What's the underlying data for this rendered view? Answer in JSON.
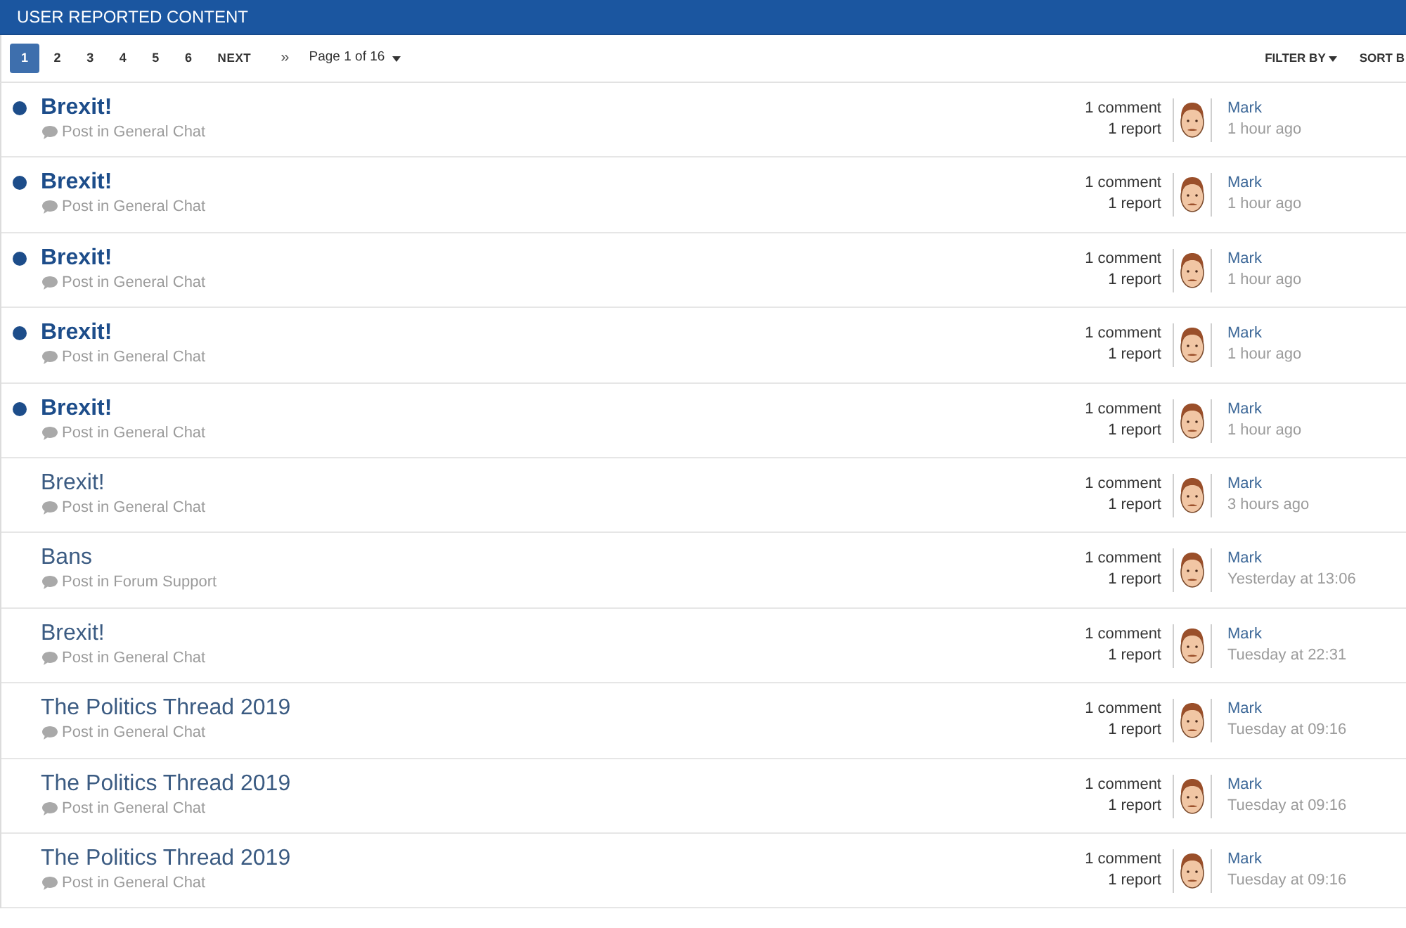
{
  "header": {
    "title": "USER REPORTED CONTENT"
  },
  "pagination": {
    "pages": [
      {
        "label": "1",
        "selected": true
      },
      {
        "label": "2",
        "selected": false
      },
      {
        "label": "3",
        "selected": false
      },
      {
        "label": "4",
        "selected": false
      },
      {
        "label": "5",
        "selected": false
      },
      {
        "label": "6",
        "selected": false
      }
    ],
    "next": "NEXT",
    "last": "»",
    "page_menu": "Page 1 of 16"
  },
  "toolbar": {
    "filter": "FILTER BY",
    "sort": "SORT B"
  },
  "items": [
    {
      "unread": true,
      "title": "Brexit!",
      "category": "Post in General Chat",
      "comments": "1 comment",
      "reports": "1 report",
      "author": "Mark",
      "time": "1 hour ago"
    },
    {
      "unread": true,
      "title": "Brexit!",
      "category": "Post in General Chat",
      "comments": "1 comment",
      "reports": "1 report",
      "author": "Mark",
      "time": "1 hour ago"
    },
    {
      "unread": true,
      "title": "Brexit!",
      "category": "Post in General Chat",
      "comments": "1 comment",
      "reports": "1 report",
      "author": "Mark",
      "time": "1 hour ago"
    },
    {
      "unread": true,
      "title": "Brexit!",
      "category": "Post in General Chat",
      "comments": "1 comment",
      "reports": "1 report",
      "author": "Mark",
      "time": "1 hour ago"
    },
    {
      "unread": true,
      "title": "Brexit!",
      "category": "Post in General Chat",
      "comments": "1 comment",
      "reports": "1 report",
      "author": "Mark",
      "time": "1 hour ago"
    },
    {
      "unread": false,
      "title": "Brexit!",
      "category": "Post in General Chat",
      "comments": "1 comment",
      "reports": "1 report",
      "author": "Mark",
      "time": "3 hours ago"
    },
    {
      "unread": false,
      "title": "Bans",
      "category": "Post in Forum Support",
      "comments": "1 comment",
      "reports": "1 report",
      "author": "Mark",
      "time": "Yesterday at 13:06"
    },
    {
      "unread": false,
      "title": "Brexit!",
      "category": "Post in General Chat",
      "comments": "1 comment",
      "reports": "1 report",
      "author": "Mark",
      "time": "Tuesday at 22:31"
    },
    {
      "unread": false,
      "title": "The Politics Thread 2019",
      "category": "Post in General Chat",
      "comments": "1 comment",
      "reports": "1 report",
      "author": "Mark",
      "time": "Tuesday at 09:16"
    },
    {
      "unread": false,
      "title": "The Politics Thread 2019",
      "category": "Post in General Chat",
      "comments": "1 comment",
      "reports": "1 report",
      "author": "Mark",
      "time": "Tuesday at 09:16"
    },
    {
      "unread": false,
      "title": "The Politics Thread 2019",
      "category": "Post in General Chat",
      "comments": "1 comment",
      "reports": "1 report",
      "author": "Mark",
      "time": "Tuesday at 09:16"
    }
  ]
}
